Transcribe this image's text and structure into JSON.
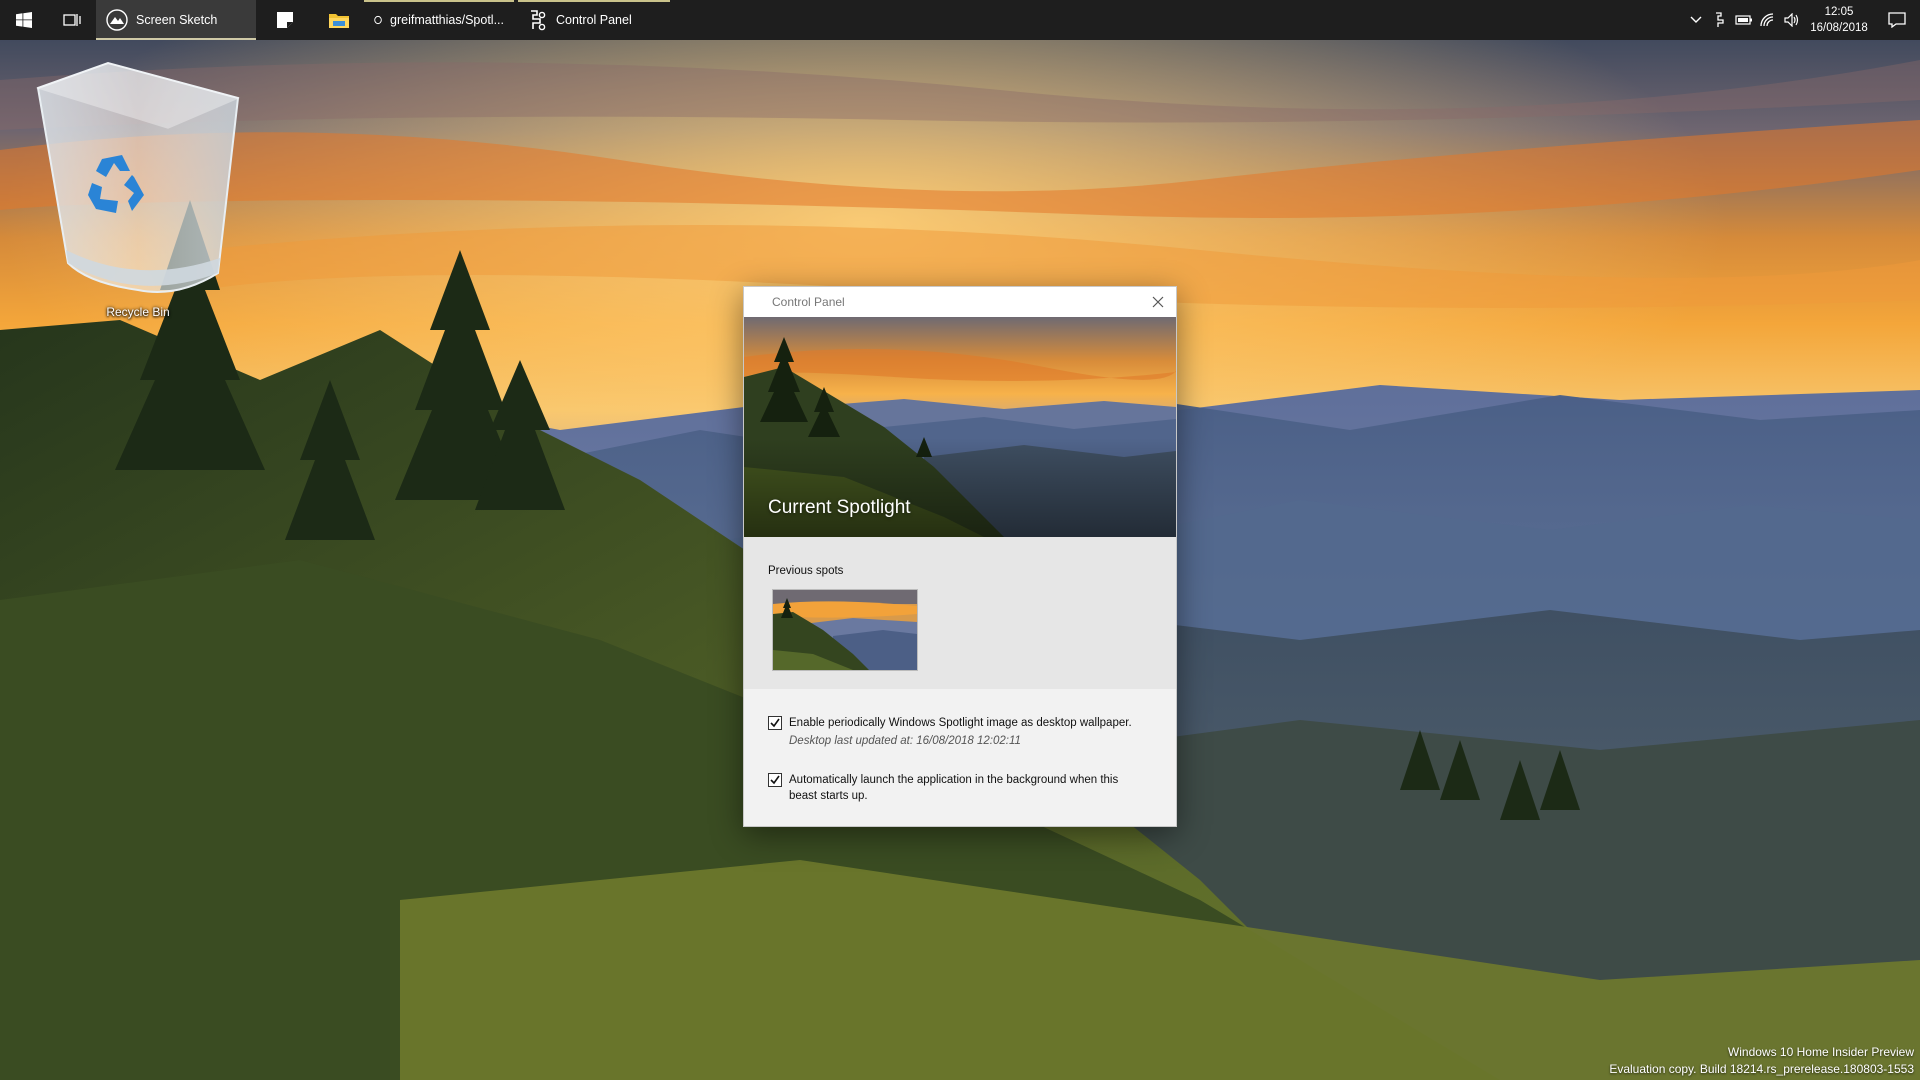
{
  "taskbar": {
    "apps": [
      {
        "label": "Screen Sketch",
        "icon": "screen-sketch-icon",
        "active": true
      },
      {
        "label": "greifmatthias/Spotl...",
        "icon": "opera-icon"
      },
      {
        "label": "Control Panel",
        "icon": "control-panel-icon"
      }
    ],
    "clock": {
      "time": "12:05",
      "date": "16/08/2018"
    }
  },
  "desktop": {
    "recycle_bin_label": "Recycle Bin"
  },
  "dialog": {
    "title": "Control Panel",
    "hero_title": "Current Spotlight",
    "previous_label": "Previous spots",
    "option1_label": "Enable periodically Windows Spotlight image as desktop wallpaper.",
    "option1_sub": "Desktop last updated at: 16/08/2018 12:02:11",
    "option1_checked": true,
    "option2_label": "Automatically launch the application in the background when this beast starts up.",
    "option2_checked": true
  },
  "watermark": {
    "line1": "Windows 10 Home Insider Preview",
    "line2": "Evaluation copy. Build 18214.rs_prerelease.180803-1553"
  },
  "colors": {
    "taskbar_bg": "#1e1e1e",
    "dialog_prev_bg": "#e6e6e6",
    "dialog_options_bg": "#f2f2f2"
  }
}
